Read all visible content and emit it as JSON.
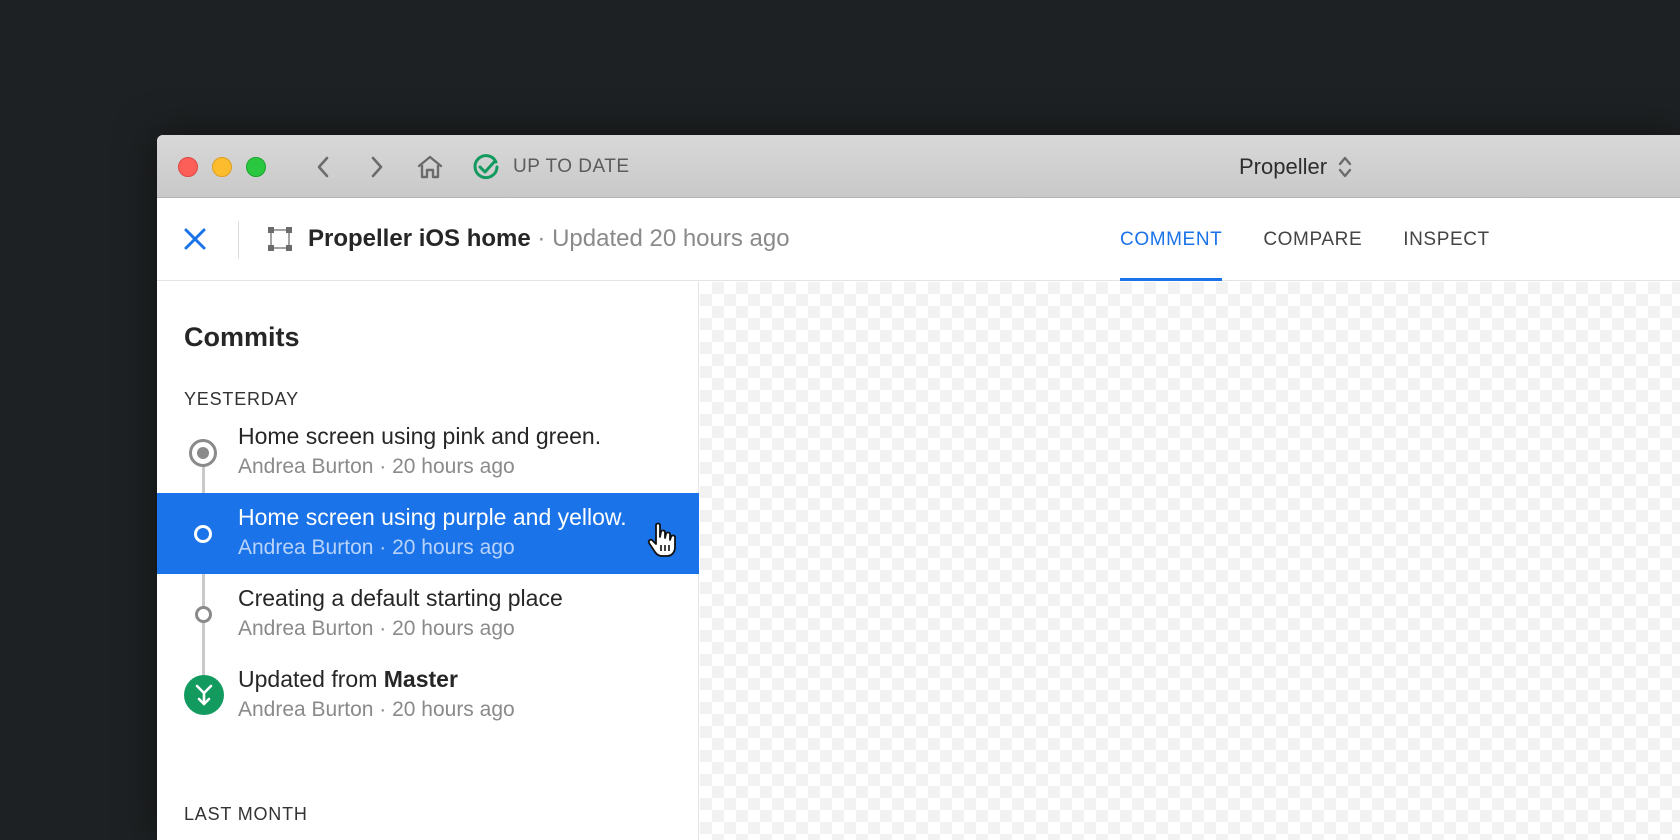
{
  "titlebar": {
    "status_text": "UP TO DATE",
    "project_name": "Propeller"
  },
  "header": {
    "doc_name": "Propeller iOS home",
    "separator": " · ",
    "updated": "Updated 20 hours ago",
    "tabs": [
      {
        "label": "COMMENT",
        "active": true
      },
      {
        "label": "COMPARE",
        "active": false
      },
      {
        "label": "INSPECT",
        "active": false
      }
    ]
  },
  "sidebar": {
    "title": "Commits",
    "groups": [
      {
        "label": "YESTERDAY"
      },
      {
        "label": "LAST MONTH"
      }
    ],
    "commits": [
      {
        "title": "Home screen using pink and green.",
        "meta": "Andrea Burton · 20 hours ago",
        "node": "head-icon"
      },
      {
        "title": "Home screen using purple and yellow.",
        "meta": "Andrea Burton · 20 hours ago",
        "node": "selected-node-icon",
        "selected": true
      },
      {
        "title": "Creating a default starting place",
        "meta": "Andrea Burton · 20 hours ago",
        "node": "commit-node-icon"
      },
      {
        "title_prefix": "Updated from ",
        "title_bold": "Master",
        "meta": "Andrea Burton · 20 hours ago",
        "node": "merge-icon"
      }
    ]
  },
  "colors": {
    "accent": "#1a73e8",
    "success": "#129a5f",
    "close_light": "#fc5f57",
    "minimize_light": "#fdbc2e",
    "maximize_light": "#29c840"
  }
}
